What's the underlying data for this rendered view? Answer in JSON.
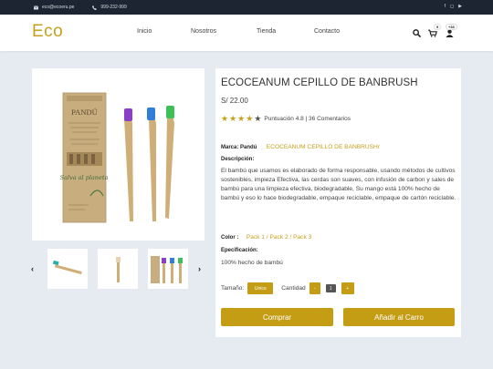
{
  "topbar": {
    "email": "eco@ecoeru.pe",
    "phone": "999-232-999",
    "socials": [
      "facebook-icon",
      "instagram-icon",
      "youtube-icon"
    ]
  },
  "header": {
    "logo": "Eco",
    "nav": [
      "Inicio",
      "Nosotros",
      "Tienda",
      "Contacto"
    ],
    "cart_badge": "9",
    "user_badge": "+33"
  },
  "product": {
    "title": "ECOCEANUM CEPILLO DE BANBRUSH",
    "price": "S/ 22.00",
    "stars_filled": 4,
    "stars_total": 5,
    "rating_text": "Puntuación 4.8 | 36 Comentarios",
    "brand_label": "Marca: Pandú",
    "brand_link": "ECOCEANUM CEPILLO DE BANBRUSHr",
    "description_label": "Descripción:",
    "description": "El bambú que usamos es elaborado de forma responsable, usando métodos de cultivos sostenibles, impieza Efectiva, las cerdas son suaves, con infusión de carbon y sales de bambú para una limpieza efectiva, biodegradable, Su mango está 100% hecho de bambú y eso lo hace biodegradable, empaque reciclable, empaque de cartón reciclable.",
    "color_label": "Color :",
    "color_options": "Pack 1 / Pack 2 / Pack 3",
    "spec_label": "Epecificación:",
    "spec": "100% hecho de bambú",
    "size_label": "Tamaño:",
    "size_value": "Unico",
    "qty_label": "Cantidad",
    "qty_minus": "-",
    "qty_value": "1",
    "qty_plus": "+",
    "buy": "Comprar",
    "add_cart": "Añadir al Carro",
    "box_brand": "PANDÚ",
    "box_slogan": "Salva al planeta"
  },
  "colors": {
    "accent": "#c69f1c",
    "topbar": "#1c2531",
    "background": "#e6eaf1",
    "brush_purple": "#8a3fc9",
    "brush_blue": "#2f7fd8",
    "brush_green": "#3fbf5a"
  }
}
